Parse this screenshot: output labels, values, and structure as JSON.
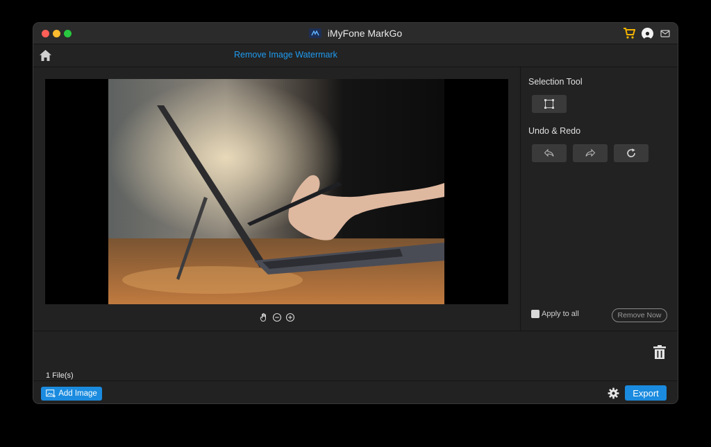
{
  "window": {
    "title": "iMyFone MarkGo"
  },
  "nav": {
    "page_title": "Remove Image Watermark"
  },
  "side": {
    "selection_tool_label": "Selection Tool",
    "undo_redo_label": "Undo & Redo",
    "apply_all_label": "Apply to all",
    "apply_all_checked": false,
    "remove_now_label": "Remove Now"
  },
  "files": {
    "count_label": "1 File(s)"
  },
  "footer": {
    "add_image_label": "Add Image",
    "export_label": "Export"
  },
  "colors": {
    "accent": "#1a8bdf",
    "title_blue": "#1f9bf0",
    "cart": "#f5b400"
  }
}
